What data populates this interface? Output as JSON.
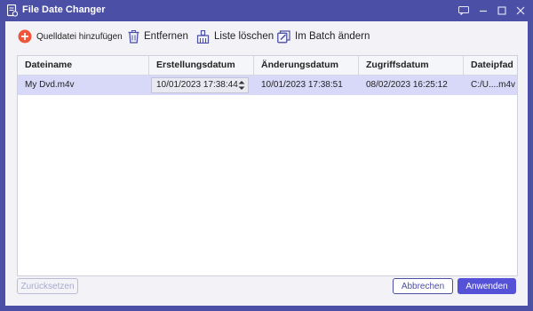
{
  "window": {
    "title": "File Date Changer"
  },
  "toolbar": {
    "add_label": "Quelldatei hinzufügen",
    "remove_label": "Entfernen",
    "clear_label": "Liste löschen",
    "batch_label": "Im Batch ändern"
  },
  "table": {
    "columns": [
      "Dateiname",
      "Erstellungsdatum",
      "Änderungsdatum",
      "Zugriffsdatum",
      "Dateipfad"
    ],
    "rows": [
      {
        "name": "My Dvd.m4v",
        "created": "10/01/2023 17:38:44",
        "modified": "10/01/2023 17:38:51",
        "accessed": "08/02/2023 16:25:12",
        "path": "C:/U....m4v"
      }
    ]
  },
  "footer": {
    "reset_label": "Zurücksetzen",
    "cancel_label": "Abbrechen",
    "apply_label": "Anwenden"
  },
  "colors": {
    "accent": "#4b4fa6",
    "add_icon": "#f0553a",
    "selected_row": "#d8d8f8",
    "primary_button": "#5552d8"
  }
}
